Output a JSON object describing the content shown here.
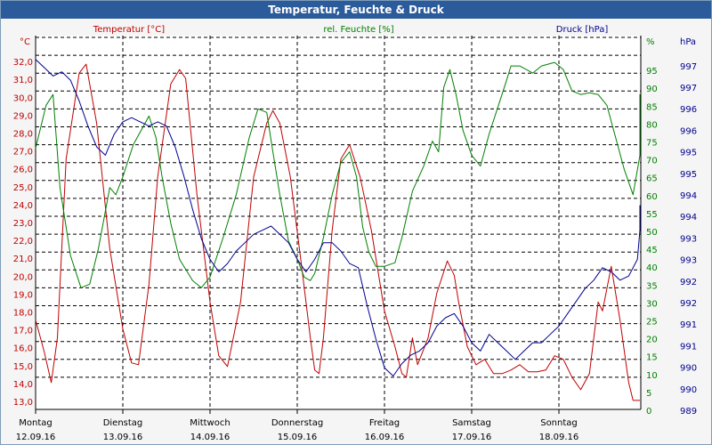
{
  "window": {
    "title": "Temperatur, Feuchte & Druck"
  },
  "chart_data": {
    "type": "line",
    "title": "Temperatur, Feuchte & Druck",
    "colors": {
      "temperature": "#c00000",
      "humidity": "#008000",
      "pressure": "#000090",
      "grid": "#000000",
      "background": "#ffffff"
    },
    "grid": true,
    "x_days": [
      {
        "day": "Montag",
        "date": "12.09.16"
      },
      {
        "day": "Dienstag",
        "date": "13.09.16"
      },
      {
        "day": "Mittwoch",
        "date": "14.09.16"
      },
      {
        "day": "Donnerstag",
        "date": "15.09.16"
      },
      {
        "day": "Freitag",
        "date": "16.09.16"
      },
      {
        "day": "Samstag",
        "date": "17.09.16"
      },
      {
        "day": "Sonntag",
        "date": "18.09.16"
      }
    ],
    "x_range_days": [
      0,
      7
    ],
    "axes": {
      "temperature": {
        "label": "Temperatur [°C]",
        "unit": "°C",
        "ylim": [
          13.0,
          33.0
        ],
        "ticks": [
          "13,0",
          "14,0",
          "15,0",
          "16,0",
          "17,0",
          "18,0",
          "19,0",
          "20,0",
          "21,0",
          "22,0",
          "23,0",
          "24,0",
          "25,0",
          "26,0",
          "27,0",
          "28,0",
          "29,0",
          "30,0",
          "31,0",
          "32,0"
        ]
      },
      "humidity": {
        "label": "rel. Feuchte [%]",
        "unit": "%",
        "ylim": [
          0,
          100
        ],
        "ticks": [
          "0",
          "5",
          "10",
          "15",
          "20",
          "25",
          "30",
          "35",
          "40",
          "45",
          "50",
          "55",
          "60",
          "65",
          "70",
          "75",
          "80",
          "85",
          "90",
          "95"
        ]
      },
      "pressure": {
        "label": "Druck [hPa]",
        "unit": "hPa",
        "ticks": [
          "989",
          "990",
          "990",
          "991",
          "991",
          "992",
          "992",
          "993",
          "993",
          "994",
          "994",
          "995",
          "995",
          "996",
          "996",
          "997",
          "997"
        ]
      }
    },
    "series": [
      {
        "name": "Temperatur [°C]",
        "axis": "temperature",
        "points": [
          [
            0.0,
            18.0
          ],
          [
            0.1,
            16.2
          ],
          [
            0.18,
            14.5
          ],
          [
            0.25,
            17.0
          ],
          [
            0.35,
            27.0
          ],
          [
            0.5,
            31.8
          ],
          [
            0.58,
            32.3
          ],
          [
            0.7,
            29.0
          ],
          [
            0.85,
            22.0
          ],
          [
            1.0,
            17.5
          ],
          [
            1.1,
            15.6
          ],
          [
            1.18,
            15.5
          ],
          [
            1.3,
            20.0
          ],
          [
            1.4,
            26.0
          ],
          [
            1.55,
            31.2
          ],
          [
            1.65,
            32.0
          ],
          [
            1.72,
            31.5
          ],
          [
            1.85,
            25.0
          ],
          [
            2.0,
            19.0
          ],
          [
            2.1,
            16.0
          ],
          [
            2.2,
            15.4
          ],
          [
            2.35,
            19.0
          ],
          [
            2.5,
            26.0
          ],
          [
            2.65,
            29.0
          ],
          [
            2.72,
            29.7
          ],
          [
            2.8,
            29.0
          ],
          [
            2.92,
            26.0
          ],
          [
            3.05,
            21.0
          ],
          [
            3.15,
            17.0
          ],
          [
            3.2,
            15.2
          ],
          [
            3.25,
            15.0
          ],
          [
            3.3,
            17.0
          ],
          [
            3.4,
            23.0
          ],
          [
            3.5,
            27.0
          ],
          [
            3.6,
            27.8
          ],
          [
            3.72,
            26.0
          ],
          [
            3.85,
            23.0
          ],
          [
            4.0,
            18.5
          ],
          [
            4.12,
            16.5
          ],
          [
            4.2,
            15.0
          ],
          [
            4.25,
            14.8
          ],
          [
            4.32,
            17.0
          ],
          [
            4.38,
            15.5
          ],
          [
            4.5,
            17.0
          ],
          [
            4.6,
            19.5
          ],
          [
            4.72,
            21.3
          ],
          [
            4.8,
            20.5
          ],
          [
            4.85,
            19.0
          ],
          [
            4.95,
            16.5
          ],
          [
            5.05,
            15.5
          ],
          [
            5.15,
            15.8
          ],
          [
            5.25,
            15.0
          ],
          [
            5.35,
            15.0
          ],
          [
            5.45,
            15.2
          ],
          [
            5.55,
            15.5
          ],
          [
            5.65,
            15.1
          ],
          [
            5.75,
            15.1
          ],
          [
            5.85,
            15.2
          ],
          [
            5.95,
            16.0
          ],
          [
            6.05,
            15.8
          ],
          [
            6.15,
            14.8
          ],
          [
            6.25,
            14.1
          ],
          [
            6.35,
            15.0
          ],
          [
            6.45,
            19.0
          ],
          [
            6.5,
            18.5
          ],
          [
            6.6,
            21.0
          ],
          [
            6.7,
            18.0
          ],
          [
            6.8,
            14.5
          ],
          [
            6.85,
            13.5
          ],
          [
            6.95,
            13.5
          ]
        ]
      },
      {
        "name": "rel. Feuchte [%]",
        "axis": "humidity",
        "points": [
          [
            0.0,
            73.0
          ],
          [
            0.12,
            85.0
          ],
          [
            0.2,
            88.0
          ],
          [
            0.28,
            62.0
          ],
          [
            0.4,
            43.0
          ],
          [
            0.52,
            34.0
          ],
          [
            0.62,
            35.0
          ],
          [
            0.72,
            45.0
          ],
          [
            0.85,
            62.0
          ],
          [
            0.92,
            60.0
          ],
          [
            1.0,
            65.0
          ],
          [
            1.12,
            74.0
          ],
          [
            1.3,
            82.0
          ],
          [
            1.38,
            76.0
          ],
          [
            1.45,
            65.0
          ],
          [
            1.55,
            52.0
          ],
          [
            1.65,
            42.0
          ],
          [
            1.8,
            36.0
          ],
          [
            1.9,
            34.0
          ],
          [
            2.0,
            37.0
          ],
          [
            2.15,
            48.0
          ],
          [
            2.3,
            60.0
          ],
          [
            2.45,
            76.0
          ],
          [
            2.55,
            84.0
          ],
          [
            2.65,
            83.0
          ],
          [
            2.72,
            72.0
          ],
          [
            2.8,
            60.0
          ],
          [
            2.9,
            47.0
          ],
          [
            3.0,
            42.0
          ],
          [
            3.08,
            37.0
          ],
          [
            3.15,
            36.0
          ],
          [
            3.2,
            38.0
          ],
          [
            3.3,
            48.0
          ],
          [
            3.4,
            60.0
          ],
          [
            3.5,
            69.0
          ],
          [
            3.6,
            72.0
          ],
          [
            3.68,
            65.0
          ],
          [
            3.75,
            51.0
          ],
          [
            3.82,
            44.0
          ],
          [
            3.9,
            40.0
          ],
          [
            4.0,
            40.0
          ],
          [
            4.12,
            41.0
          ],
          [
            4.2,
            48.0
          ],
          [
            4.32,
            61.0
          ],
          [
            4.45,
            68.0
          ],
          [
            4.55,
            75.0
          ],
          [
            4.62,
            72.0
          ],
          [
            4.68,
            90.0
          ],
          [
            4.75,
            95.0
          ],
          [
            4.82,
            88.0
          ],
          [
            4.9,
            78.0
          ],
          [
            5.0,
            71.0
          ],
          [
            5.1,
            68.0
          ],
          [
            5.2,
            77.0
          ],
          [
            5.32,
            86.0
          ],
          [
            5.4,
            92.0
          ],
          [
            5.45,
            96.0
          ],
          [
            5.55,
            96.0
          ],
          [
            5.7,
            94.0
          ],
          [
            5.8,
            96.0
          ],
          [
            5.95,
            97.0
          ],
          [
            6.05,
            95.0
          ],
          [
            6.15,
            89.0
          ],
          [
            6.25,
            88.0
          ],
          [
            6.35,
            88.5
          ],
          [
            6.45,
            88.0
          ],
          [
            6.55,
            85.0
          ],
          [
            6.65,
            76.0
          ],
          [
            6.75,
            67.0
          ],
          [
            6.85,
            60.0
          ],
          [
            6.95,
            71.0
          ],
          [
            7.0,
            82.0
          ],
          [
            7.05,
            88.0
          ],
          [
            7.15,
            86.0
          ],
          [
            7.22,
            78.0
          ]
        ]
      },
      {
        "name": "Druck [hPa]",
        "axis": "pressure",
        "points": [
          [
            0.0,
            997.4
          ],
          [
            0.1,
            997.2
          ],
          [
            0.2,
            997.0
          ],
          [
            0.3,
            997.1
          ],
          [
            0.4,
            996.9
          ],
          [
            0.5,
            996.4
          ],
          [
            0.6,
            995.8
          ],
          [
            0.7,
            995.3
          ],
          [
            0.8,
            995.1
          ],
          [
            0.9,
            995.6
          ],
          [
            1.0,
            995.9
          ],
          [
            1.1,
            996.0
          ],
          [
            1.2,
            995.9
          ],
          [
            1.3,
            995.8
          ],
          [
            1.4,
            995.9
          ],
          [
            1.5,
            995.8
          ],
          [
            1.6,
            995.3
          ],
          [
            1.7,
            994.6
          ],
          [
            1.8,
            993.8
          ],
          [
            1.9,
            993.1
          ],
          [
            2.0,
            992.6
          ],
          [
            2.1,
            992.3
          ],
          [
            2.2,
            992.5
          ],
          [
            2.3,
            992.8
          ],
          [
            2.4,
            993.0
          ],
          [
            2.5,
            993.2
          ],
          [
            2.6,
            993.3
          ],
          [
            2.7,
            993.4
          ],
          [
            2.8,
            993.2
          ],
          [
            2.9,
            993.0
          ],
          [
            3.0,
            992.6
          ],
          [
            3.1,
            992.3
          ],
          [
            3.2,
            992.6
          ],
          [
            3.3,
            993.0
          ],
          [
            3.4,
            993.0
          ],
          [
            3.5,
            992.8
          ],
          [
            3.6,
            992.5
          ],
          [
            3.7,
            992.4
          ],
          [
            3.8,
            991.5
          ],
          [
            3.9,
            990.7
          ],
          [
            4.0,
            990.0
          ],
          [
            4.1,
            989.8
          ],
          [
            4.2,
            990.1
          ],
          [
            4.3,
            990.3
          ],
          [
            4.4,
            990.4
          ],
          [
            4.5,
            990.6
          ],
          [
            4.6,
            991.0
          ],
          [
            4.7,
            991.2
          ],
          [
            4.8,
            991.3
          ],
          [
            4.9,
            991.0
          ],
          [
            5.0,
            990.6
          ],
          [
            5.1,
            990.4
          ],
          [
            5.2,
            990.8
          ],
          [
            5.3,
            990.6
          ],
          [
            5.4,
            990.4
          ],
          [
            5.5,
            990.2
          ],
          [
            5.6,
            990.4
          ],
          [
            5.7,
            990.6
          ],
          [
            5.8,
            990.6
          ],
          [
            5.9,
            990.8
          ],
          [
            6.0,
            991.0
          ],
          [
            6.1,
            991.3
          ],
          [
            6.2,
            991.6
          ],
          [
            6.3,
            991.9
          ],
          [
            6.4,
            992.1
          ],
          [
            6.5,
            992.4
          ],
          [
            6.6,
            992.3
          ],
          [
            6.7,
            992.1
          ],
          [
            6.8,
            992.2
          ],
          [
            6.9,
            992.6
          ],
          [
            7.0,
            993.3
          ],
          [
            7.1,
            993.7
          ],
          [
            7.2,
            993.9
          ]
        ]
      }
    ]
  }
}
